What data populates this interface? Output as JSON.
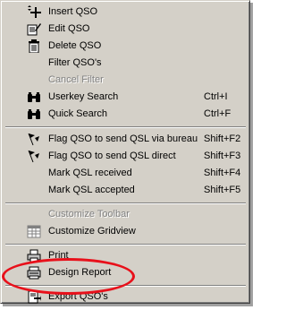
{
  "menu": {
    "items": [
      {
        "label": "Insert QSO",
        "shortcut": "",
        "icon": "insert-icon",
        "enabled": true
      },
      {
        "label": "Edit QSO",
        "shortcut": "",
        "icon": "edit-icon",
        "enabled": true
      },
      {
        "label": "Delete QSO",
        "shortcut": "",
        "icon": "trash-icon",
        "enabled": true
      },
      {
        "label": "Filter QSO's",
        "shortcut": "",
        "icon": "",
        "enabled": true
      },
      {
        "label": "Cancel Filter",
        "shortcut": "",
        "icon": "",
        "enabled": false
      },
      {
        "label": "Userkey Search",
        "shortcut": "Ctrl+I",
        "icon": "binoculars-icon",
        "enabled": true
      },
      {
        "label": "Quick Search",
        "shortcut": "Ctrl+F",
        "icon": "binoculars-icon",
        "enabled": true
      },
      {
        "label": "Flag QSO to send QSL via bureau",
        "shortcut": "Shift+F2",
        "icon": "flag-icon",
        "enabled": true
      },
      {
        "label": "Flag QSO to send QSL direct",
        "shortcut": "Shift+F3",
        "icon": "flag-icon",
        "enabled": true
      },
      {
        "label": "Mark QSL received",
        "shortcut": "Shift+F4",
        "icon": "",
        "enabled": true
      },
      {
        "label": "Mark QSL accepted",
        "shortcut": "Shift+F5",
        "icon": "",
        "enabled": true
      },
      {
        "label": "Customize Toolbar",
        "shortcut": "",
        "icon": "toolbar-icon",
        "enabled": false
      },
      {
        "label": "Customize Gridview",
        "shortcut": "",
        "icon": "grid-icon",
        "enabled": true
      },
      {
        "label": "Print",
        "shortcut": "",
        "icon": "printer-icon",
        "enabled": true
      },
      {
        "label": "Design Report",
        "shortcut": "",
        "icon": "report-icon",
        "enabled": true
      },
      {
        "label": "Export QSO's",
        "shortcut": "",
        "icon": "export-icon",
        "enabled": true
      }
    ]
  },
  "colors": {
    "menu_bg": "#d4d0c8",
    "disabled_text": "#808080",
    "highlight_ellipse": "#e8101a"
  }
}
